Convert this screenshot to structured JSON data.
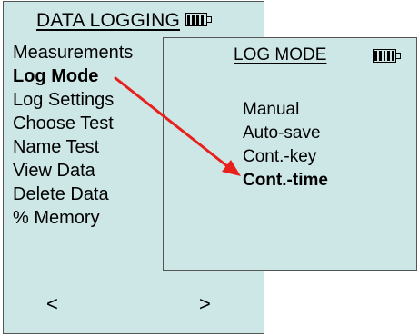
{
  "main": {
    "title": "DATA LOGGING",
    "battery_icon": "battery-full-icon",
    "menu": [
      {
        "label": "Measurements",
        "selected": false
      },
      {
        "label": "Log Mode",
        "selected": true
      },
      {
        "label": "Log Settings",
        "selected": false
      },
      {
        "label": "Choose Test",
        "selected": false
      },
      {
        "label": "Name Test",
        "selected": false
      },
      {
        "label": "View Data",
        "selected": false
      },
      {
        "label": "Delete Data",
        "selected": false
      },
      {
        "label": "% Memory",
        "selected": false
      }
    ],
    "nav": {
      "prev": "<",
      "next": ">"
    }
  },
  "popup": {
    "title": "LOG MODE",
    "battery_icon": "battery-full-icon",
    "options": [
      {
        "label": "Manual",
        "selected": false
      },
      {
        "label": "Auto-save",
        "selected": false
      },
      {
        "label": "Cont.-key",
        "selected": false
      },
      {
        "label": "Cont.-time",
        "selected": true
      }
    ]
  },
  "colors": {
    "screen_bg": "#cde6e6",
    "arrow": "#e8201c"
  }
}
